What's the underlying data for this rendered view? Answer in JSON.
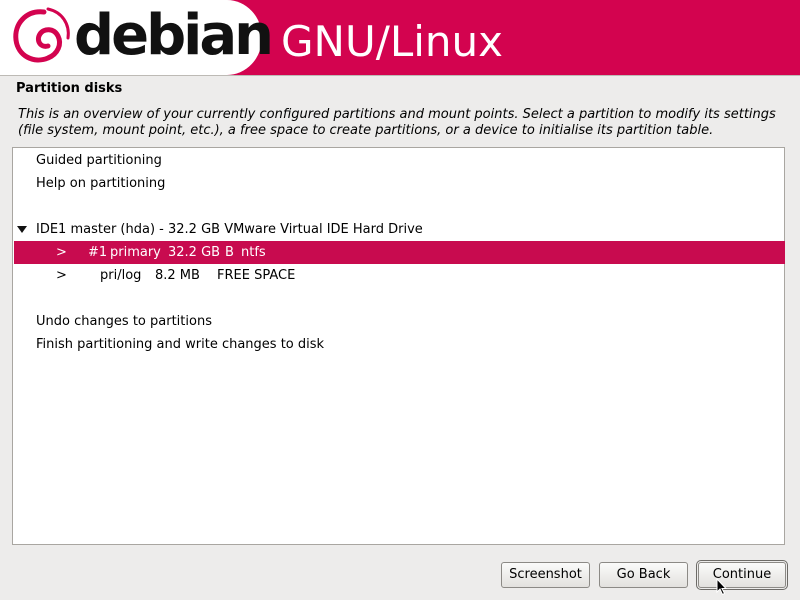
{
  "banner": {
    "logo_text": "debian",
    "subtitle": "GNU/Linux",
    "accent_color": "#d3034f"
  },
  "page": {
    "title": "Partition disks",
    "description": "This is an overview of your currently configured partitions and mount points. Select a partition to modify its settings (file system, mount point, etc.), a free space to create partitions, or a device to initialise its partition table."
  },
  "list": {
    "guided": "Guided partitioning",
    "help": "Help on partitioning",
    "disk": "IDE1 master (hda) - 32.2 GB VMware Virtual IDE Hard Drive",
    "partitions": [
      {
        "marker": ">",
        "number": "#1",
        "type": "primary",
        "size": "32.2 GB",
        "flag": "B",
        "fs": "ntfs"
      },
      {
        "marker": ">",
        "type": "pri/log",
        "size": "8.2 MB",
        "fs": "FREE SPACE"
      }
    ],
    "undo": "Undo changes to partitions",
    "finish": "Finish partitioning and write changes to disk",
    "selected_color": "#c80b4f"
  },
  "buttons": {
    "screenshot": "Screenshot",
    "back": "Go Back",
    "continue": "Continue"
  }
}
